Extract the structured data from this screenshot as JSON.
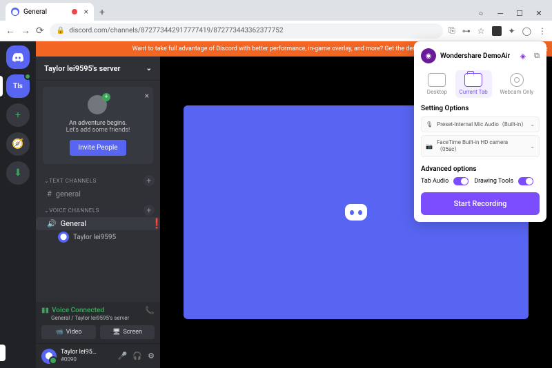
{
  "browser": {
    "tab_title": "General",
    "url": "discord.com/channels/872773442917777419/872773443362377752"
  },
  "discord": {
    "banner_text": "Want to take full advantage of Discord with better performance, in-game overlay, and more? Get the desktop app!",
    "server_label": "Tls",
    "server_name": "Taylor lei9595's server",
    "invite": {
      "line1": "An adventure begins.",
      "line2": "Let's add some friends!",
      "button": "Invite People"
    },
    "sections": {
      "text": "TEXT CHANNELS",
      "voice": "VOICE CHANNELS"
    },
    "channels": {
      "general_text": "general",
      "general_voice": "General"
    },
    "vc_user": "Taylor lei9595",
    "voice_status": {
      "label": "Voice Connected",
      "sub": "General / Taylor lei9595's server"
    },
    "buttons": {
      "video": "Video",
      "screen": "Screen"
    },
    "user": {
      "name": "Taylor lei95…",
      "tag": "#0090"
    }
  },
  "popup": {
    "brand": "Wondershare DemoAir",
    "modes": {
      "desktop": "Desktop",
      "current_tab": "Current Tab",
      "webcam_only": "Webcam Only"
    },
    "setting_options": "Setting Options",
    "mic": "Preset-Internal Mic Audio（Built-in）",
    "camera": "FaceTime Built-in HD camera（05ac）",
    "advanced": "Advanced options",
    "tab_audio": "Tab Audio",
    "drawing_tools": "Drawing Tools",
    "start": "Start Recording"
  }
}
